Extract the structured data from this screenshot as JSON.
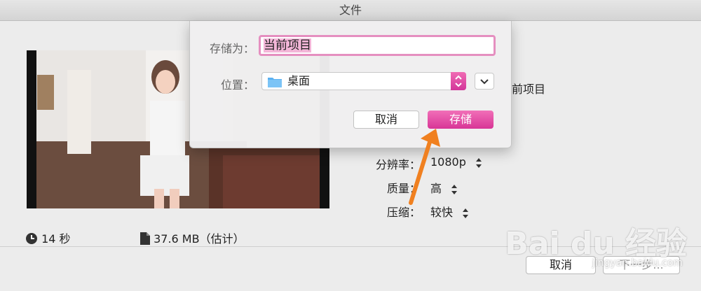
{
  "window": {
    "title": "文件"
  },
  "preview": {
    "partial_title": "前项目"
  },
  "settings": {
    "resolution": {
      "label": "分辨率：",
      "value": "1080p"
    },
    "quality": {
      "label": "质量：",
      "value": "高"
    },
    "compression": {
      "label": "压缩：",
      "value": "较快"
    }
  },
  "footer": {
    "duration": "14 秒",
    "size": "37.6 MB（估计）",
    "cancel_label": "取消",
    "next_label": "下一步..."
  },
  "dialog": {
    "save_as_label": "存储为：",
    "save_as_value": "当前项目",
    "location_label": "位置：",
    "location_value": "桌面",
    "cancel_label": "取消",
    "save_label": "存储"
  },
  "watermark": {
    "logo": "Bai du 经验",
    "url": "jingyan.baidu.com"
  },
  "colors": {
    "accent": "#e0409e",
    "arrow": "#f08020"
  },
  "icons": [
    "clock-icon",
    "document-icon",
    "folder-icon",
    "chevron-down-icon",
    "stepper-icon"
  ]
}
